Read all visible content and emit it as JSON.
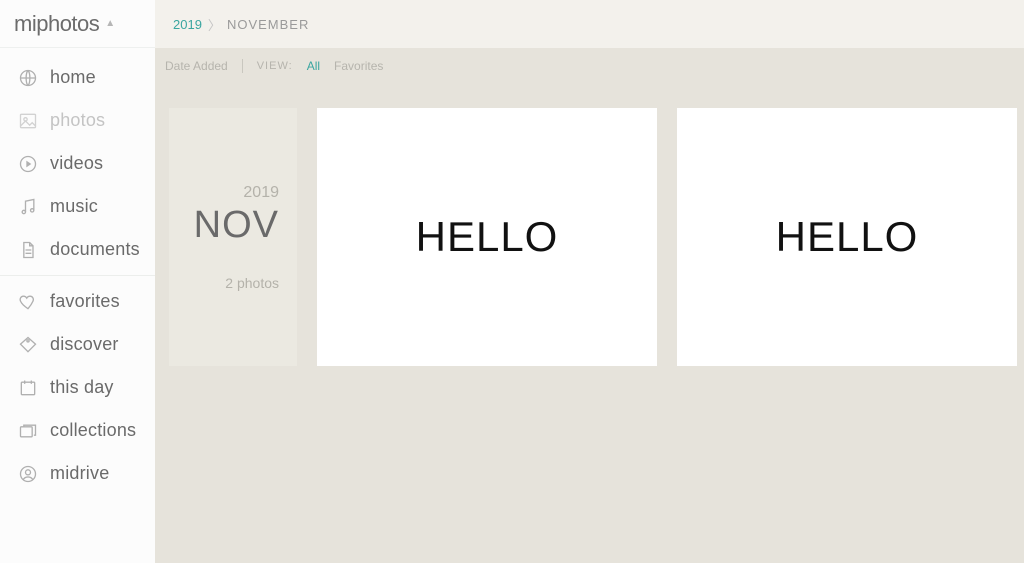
{
  "brand": {
    "prefix": "mi",
    "suffix": "photos"
  },
  "sidebar": {
    "items": [
      {
        "label": "home"
      },
      {
        "label": "photos"
      },
      {
        "label": "videos"
      },
      {
        "label": "music"
      },
      {
        "label": "documents"
      },
      {
        "label": "favorites"
      },
      {
        "label": "discover"
      },
      {
        "label": "this day"
      },
      {
        "label": "collections"
      },
      {
        "label": "midrive"
      }
    ]
  },
  "breadcrumb": {
    "year": "2019",
    "month": "NOVEMBER"
  },
  "toolbar": {
    "sort_label": "Date Added",
    "view_label": "VIEW:",
    "view_all": "All",
    "view_fav": "Favorites"
  },
  "month_card": {
    "year": "2019",
    "month": "NOV",
    "count": "2 photos"
  },
  "thumbs": [
    {
      "text": "HELLO"
    },
    {
      "text": "HELLO"
    }
  ]
}
